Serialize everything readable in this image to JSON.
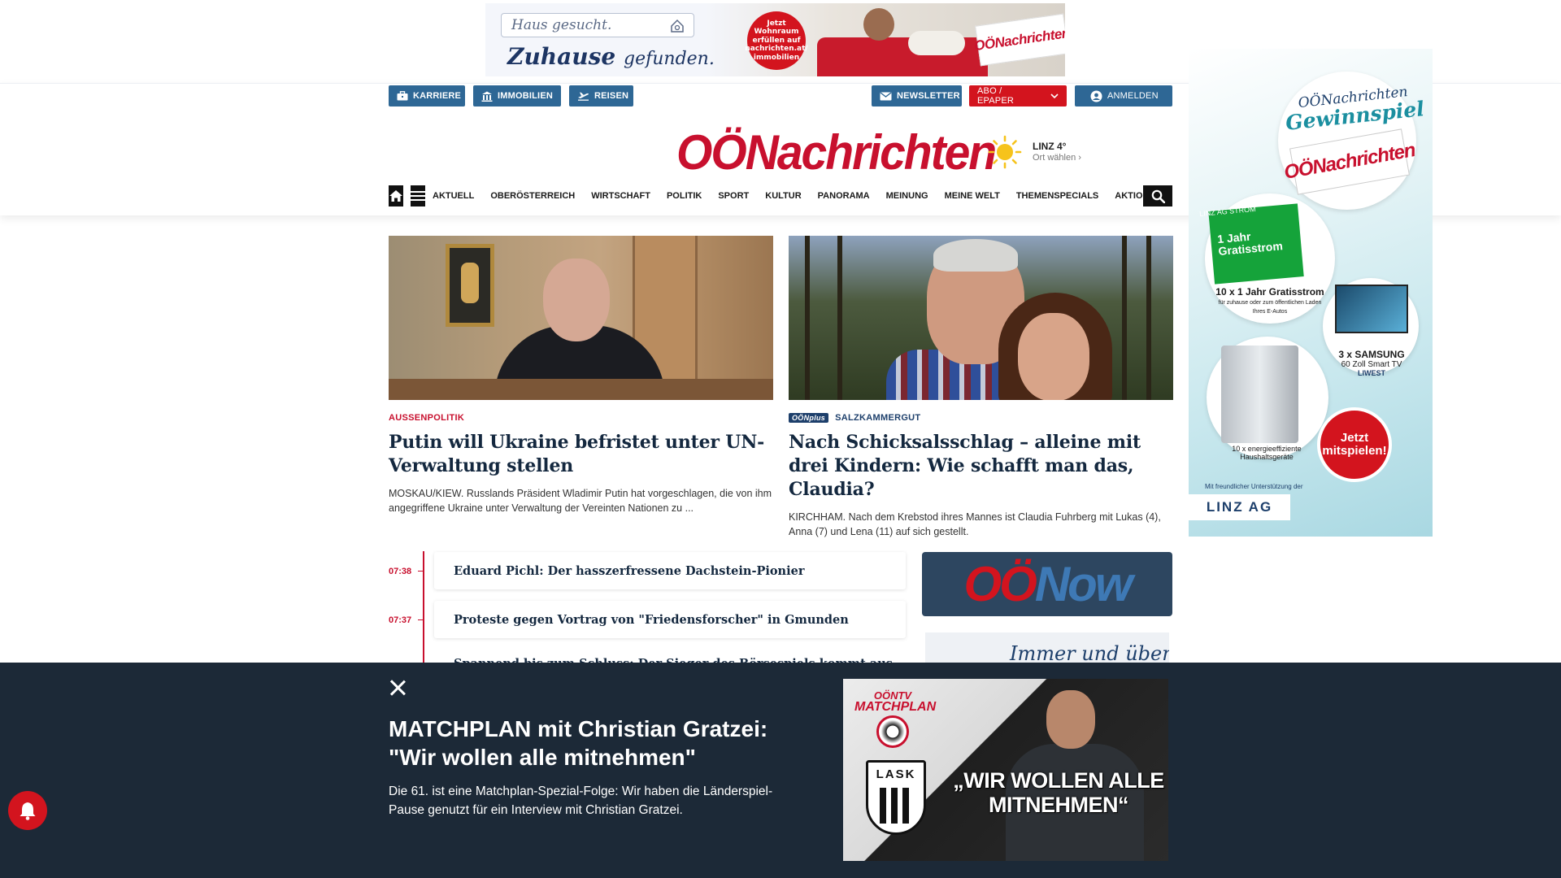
{
  "top_ad": {
    "search_placeholder": "Haus gesucht.",
    "claim_main": "Zuhause",
    "claim_small": "gefunden.",
    "badge_text": "Jetzt Wohnraum erfüllen auf nachrichten.at/ immobilien",
    "paper_logo": "OÖNachrichten"
  },
  "util_nav": {
    "karriere": "KARRIERE",
    "immobilien": "IMMOBILIEN",
    "reisen": "REISEN",
    "newsletter": "NEWSLETTER",
    "abo": "ABO / EPAPER",
    "login": "ANMELDEN"
  },
  "logo": {
    "prefix": "OÖ",
    "main": "Nachrichten"
  },
  "weather": {
    "city": "LINZ 4°",
    "choose": "Ort wählen"
  },
  "main_nav": [
    "AKTUELL",
    "OBERÖSTERREICH",
    "WIRTSCHAFT",
    "POLITIK",
    "SPORT",
    "KULTUR",
    "PANORAMA",
    "MEINUNG",
    "MEINE WELT",
    "THEMENSPECIALS",
    "AKTIONEN"
  ],
  "side_ad": {
    "title_small": "OÖNachrichten",
    "title_big": "Gewinnspiel",
    "paper_logo": "OÖNachrichten",
    "linz_strom": "LINZ AG STROM",
    "prize1_head": "1 Jahr Gratisstrom",
    "prize1_text": "10 x 1 Jahr Gratisstrom",
    "prize1_sub": "für zuhause oder zum öffentlichen Laden Ihres E-Autos",
    "prize2_text": "3 x SAMSUNG",
    "prize2_sub": "60 Zoll Smart TV",
    "prize2_brand": "LIWEST",
    "prize3_text": "10 x energieeffiziente Haushaltsgeräte",
    "cta": "Jetzt mitspielen!",
    "support": "Mit freundlicher Unterstützung der",
    "sponsor": "LINZ AG"
  },
  "teasers": [
    {
      "kicker": "AUSSENPOLITIK",
      "title": "Putin will Ukraine befristet unter UN-Verwaltung stellen",
      "lead": "MOSKAU/KIEW. Russlands Präsident Wladimir Putin hat vorgeschlagen, die von ihm angegriffene Ukraine unter Verwaltung der Vereinten Nationen zu ..."
    },
    {
      "plus_badge": "OÖNplus",
      "kicker": "SALZKAMMERGUT",
      "title": "Nach Schicksalsschlag – alleine mit drei Kindern: Wie schafft man das, Claudia?",
      "lead": "KIRCHHAM. Nach dem Krebstod ihres Mannes ist Claudia Fuhrberg mit Lukas (4), Anna (7) und Lena (11) auf sich gestellt."
    }
  ],
  "timeline": [
    {
      "time": "07:38",
      "title": "Eduard Pichl: Der hasszerfressene Dachstein-Pionier"
    },
    {
      "time": "07:37",
      "title": "Proteste gegen Vortrag von \"Friedensforscher\" in Gmunden"
    },
    {
      "time": "",
      "title": "Spannend bis zum Schluss: Der Sieger des Börsespiels kommt aus"
    }
  ],
  "oonow": {
    "oo": "OÖ",
    "now": "Now"
  },
  "immer": "Immer und überall",
  "overlay": {
    "title": "MATCHPLAN mit Christian Gratzei: \"Wir wollen alle mitnehmen\"",
    "text": "Die 61. ist eine Matchplan-Spezial-Folge: Wir haben die Länderspiel-Pause genutzt für ein Interview mit Christian Gratzei.",
    "video_brand_top": "OÖNTV",
    "video_brand": "MATCHPLAN",
    "video_club": "LASK",
    "video_caption": "„WIR WOLLEN ALLE MITNEHMEN“"
  }
}
